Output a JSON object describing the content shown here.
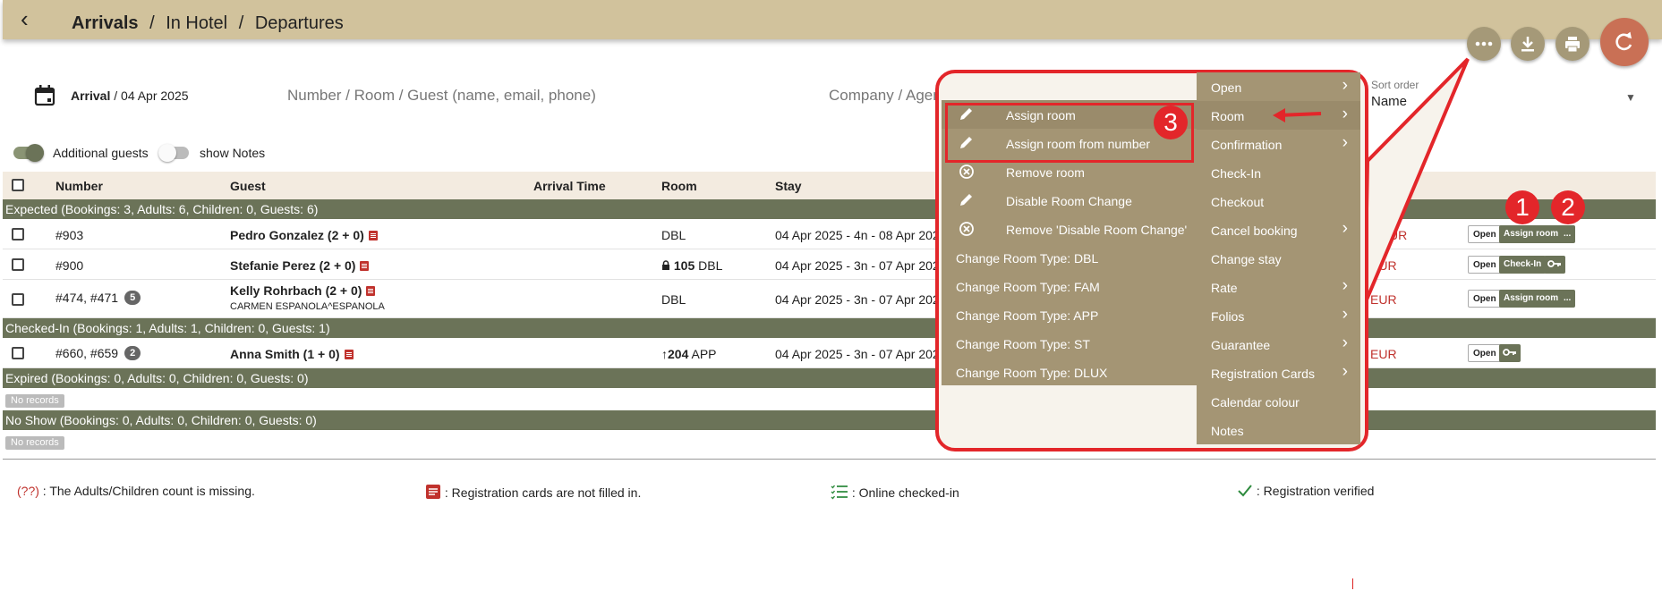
{
  "header": {
    "crumbs": [
      "Arrivals",
      "/",
      "In Hotel",
      "/",
      "Departures"
    ],
    "back_icon": "chevron-left-icon"
  },
  "toolbar": {
    "more_icon": "more-horizontal-icon",
    "download_icon": "download-icon",
    "print_icon": "print-icon",
    "refresh_icon": "refresh-icon"
  },
  "filters": {
    "arrival_label": "Arrival",
    "arrival_date": "/ 04 Apr 2025",
    "search_placeholder": "Number / Room / Guest (name, email, phone)",
    "company_placeholder": "Company / Agen",
    "sort_label": "Sort order",
    "sort_value": "Name"
  },
  "toggles": {
    "additional_guests": "Additional guests",
    "show_notes": "show Notes"
  },
  "columns": [
    "Number",
    "Guest",
    "Arrival Time",
    "Room",
    "Stay"
  ],
  "groups": {
    "expected": "Expected (Bookings: 3, Adults: 6, Children: 0, Guests: 6)",
    "checked_in": "Checked-In (Bookings: 1, Adults: 1, Children: 0, Guests: 1)",
    "expired": "Expired (Bookings: 0, Adults: 0, Children: 0, Guests: 0)",
    "no_show": "No Show (Bookings: 0, Adults: 0, Children: 0, Guests: 0)"
  },
  "rows": [
    {
      "number": "#903",
      "guest": "Pedro Gonzalez (2 + 0)",
      "room": "DBL",
      "stay": "04 Apr 2025 - 4n - 08 Apr 202",
      "amount": "0 EUR",
      "btn_open": "Open",
      "btn_action": "Assign room",
      "btn_more": "..."
    },
    {
      "number": "#900",
      "guest": "Stefanie Perez (2 + 0)",
      "room_num": "105",
      "room": "DBL",
      "stay": "04 Apr 2025 - 3n - 07 Apr 202",
      "amount": "EUR",
      "btn_open": "Open",
      "btn_action": "Check-In"
    },
    {
      "number": "#474, #471",
      "badge": "5",
      "guest": "Kelly Rohrbach (2 + 0)",
      "company": "CARMEN ESPANOLA^ESPANOLA",
      "room": "DBL",
      "stay": "04 Apr 2025 - 3n - 07 Apr 202",
      "amount": "EUR",
      "btn_open": "Open",
      "btn_action": "Assign room",
      "btn_more": "..."
    },
    {
      "number": "#660, #659",
      "badge": "2",
      "guest": "Anna Smith (1 + 0)",
      "room_num": "204",
      "room": "APP",
      "stay": "04 Apr 2025 - 3n - 07 Apr 202",
      "amount": "EUR",
      "btn_open": "Open"
    }
  ],
  "no_records": "No records",
  "legend": {
    "missing_marker": "(??)",
    "missing": ": The Adults/Children count is missing.",
    "reg_cards": ": Registration cards are not filled in.",
    "online": ": Online checked-in",
    "verified": ": Registration verified"
  },
  "context_menu": {
    "items": [
      {
        "label": "Open",
        "submenu": true
      },
      {
        "label": "Room",
        "submenu": true
      },
      {
        "label": "Confirmation",
        "submenu": true
      },
      {
        "label": "Check-In",
        "submenu": false
      },
      {
        "label": "Checkout",
        "submenu": false
      },
      {
        "label": "Cancel booking",
        "submenu": true
      },
      {
        "label": "Change stay",
        "submenu": false
      },
      {
        "label": "Rate",
        "submenu": true
      },
      {
        "label": "Folios",
        "submenu": true
      },
      {
        "label": "Guarantee",
        "submenu": true
      },
      {
        "label": "Registration Cards",
        "submenu": true
      },
      {
        "label": "Calendar colour",
        "submenu": false
      },
      {
        "label": "Notes",
        "submenu": false
      }
    ],
    "room_submenu": [
      {
        "label": "Assign room",
        "icon": "pencil-icon"
      },
      {
        "label": "Assign room from number",
        "icon": "pencil-icon"
      },
      {
        "label": "Remove room",
        "icon": "cancel-circle-icon"
      },
      {
        "label": "Disable Room Change",
        "icon": "pencil-icon"
      },
      {
        "label": "Remove 'Disable Room Change'",
        "icon": "cancel-circle-icon"
      },
      {
        "label": "Change Room Type: DBL"
      },
      {
        "label": "Change Room Type: FAM"
      },
      {
        "label": "Change Room Type: APP"
      },
      {
        "label": "Change Room Type: ST"
      },
      {
        "label": "Change Room Type: DLUX"
      }
    ]
  },
  "annotations": {
    "step1": "1",
    "step2": "2",
    "step3": "3"
  },
  "colors": {
    "header": "#d1c29c",
    "group_bar": "#6b7358",
    "menu": "#a49574",
    "annotation_red": "#e3262a"
  }
}
